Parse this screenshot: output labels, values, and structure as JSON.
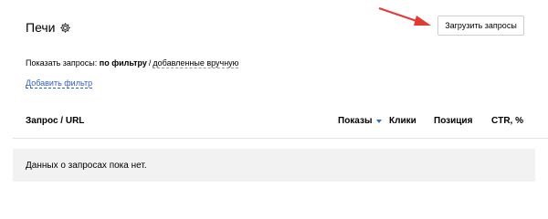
{
  "header": {
    "title": "Печи",
    "settings_icon": "gear-icon",
    "upload_button_label": "Загрузить запросы"
  },
  "filter": {
    "prefix": "Показать запросы:",
    "options": [
      "по фильтру",
      "добавленные вручную"
    ],
    "separator": "/",
    "active_option": "по фильтру",
    "add_filter_link": "Добавить фильтр"
  },
  "table": {
    "columns": [
      "Запрос / URL",
      "Показы",
      "Клики",
      "Позиция",
      "CTR, %"
    ],
    "sorted_column": "Показы",
    "empty_message": "Данных о запросах пока нет."
  },
  "colors": {
    "link": "#2f5fbf",
    "sort_indicator": "#2f6fcf",
    "annotation_arrow": "#e53a32",
    "empty_row_bg": "#f2f2f2"
  }
}
